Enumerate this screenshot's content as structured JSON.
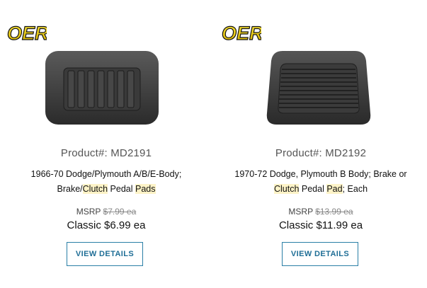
{
  "products": [
    {
      "logo_text": "OER",
      "product_label": "Product#: MD2191",
      "desc_parts": [
        "1966-70 Dodge/Plymouth A/B/E-Body; Brake/",
        "Clutch",
        " Pedal ",
        "Pads",
        ""
      ],
      "msrp_label": "MSRP",
      "msrp_value": "$7.99 ea",
      "classic_price": "Classic $6.99 ea",
      "button_label": "VIEW DETAILS",
      "image_icon": "rectangular-pedal-pad-icon"
    },
    {
      "logo_text": "OER",
      "product_label": "Product#: MD2192",
      "desc_parts": [
        "1970-72 Dodge, Plymouth B Body; Brake or ",
        "Clutch",
        " Pedal ",
        "Pad",
        "; Each"
      ],
      "msrp_label": "MSRP",
      "msrp_value": "$13.99 ea",
      "classic_price": "Classic $11.99 ea",
      "button_label": "VIEW DETAILS",
      "image_icon": "trapezoid-pedal-pad-icon"
    }
  ],
  "colors": {
    "accent": "#1f6e96",
    "highlight": "#fdf3c7",
    "logo_yellow": "#f2d21b"
  }
}
